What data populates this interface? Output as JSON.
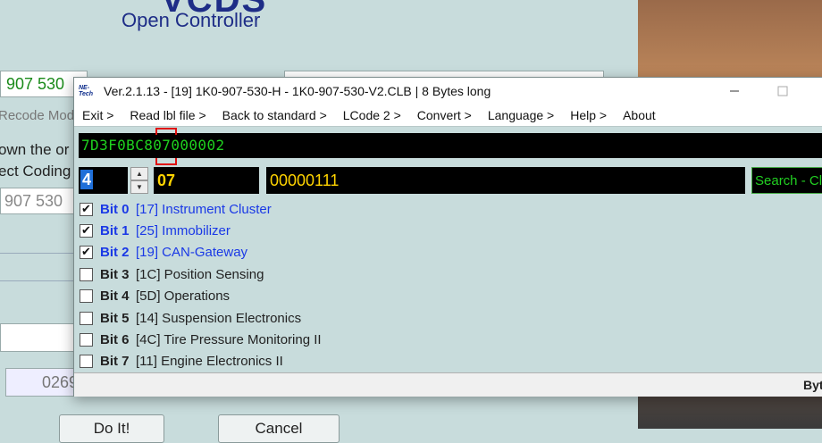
{
  "background": {
    "title_fragment": "VCDS",
    "subtitle": "Open Controller",
    "part_field": "907 530",
    "right_field": "",
    "recode_label": "Recode Modu",
    "own_text": "own the or",
    "coding_text": "ect Coding",
    "part_grey": "907 530",
    "number_field": "0269",
    "do_it_button": "Do It!",
    "cancel_button": "Cancel"
  },
  "window": {
    "logo_top": "NE-",
    "logo_bottom": "Tech",
    "title": "Ver.2.1.13 - [19] 1K0-907-530-H - 1K0-907-530-V2.CLB | 8 Bytes long",
    "minimize_icon": "minimize-icon",
    "maximize_icon": "maximize-icon"
  },
  "menu": [
    {
      "label": "Exit >"
    },
    {
      "label": "Read lbl file >"
    },
    {
      "label": "Back to standard >"
    },
    {
      "label": "LCode 2 >"
    },
    {
      "label": "Convert >"
    },
    {
      "label": "Language >"
    },
    {
      "label": "Help >"
    },
    {
      "label": "About"
    }
  ],
  "coding": {
    "hex_string": "7D3F0BC807000002",
    "byte_index": "4",
    "byte_hex": "07",
    "byte_binary": "00000111",
    "search_text": "Search - Cl"
  },
  "bits": [
    {
      "name": "Bit 0",
      "desc": "[17] Instrument Cluster",
      "checked": true
    },
    {
      "name": "Bit 1",
      "desc": "[25] Immobilizer",
      "checked": true
    },
    {
      "name": "Bit 2",
      "desc": "[19] CAN-Gateway",
      "checked": true
    },
    {
      "name": "Bit 3",
      "desc": "[1C] Position Sensing",
      "checked": false
    },
    {
      "name": "Bit 4",
      "desc": "[5D] Operations",
      "checked": false
    },
    {
      "name": "Bit 5",
      "desc": "[14] Suspension Electronics",
      "checked": false
    },
    {
      "name": "Bit 6",
      "desc": "[4C] Tire Pressure Monitoring II",
      "checked": false
    },
    {
      "name": "Bit 7",
      "desc": "[11] Engine Electronics II",
      "checked": false
    }
  ],
  "status": {
    "right_text": "Byt"
  },
  "colors": {
    "selected_bit": "#1a39e6",
    "hex_text": "#1fd11f",
    "byte_text": "#ffd400",
    "marker": "#e01010"
  }
}
